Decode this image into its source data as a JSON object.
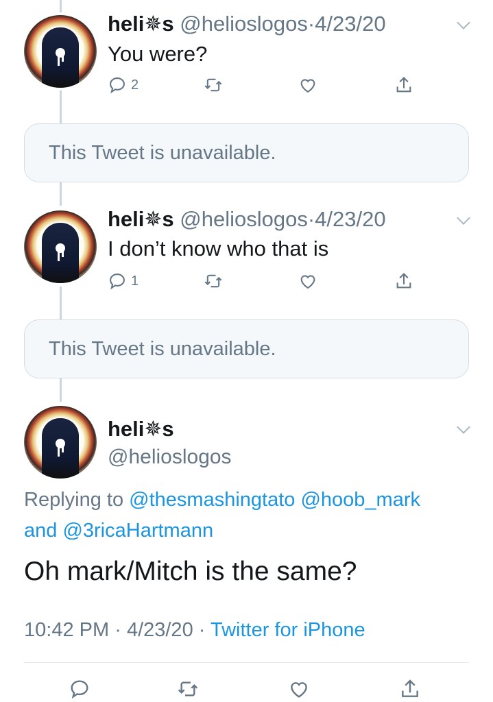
{
  "tweets": [
    {
      "name_prefix": "heli",
      "name_symbol": "✵",
      "name_suffix": "s",
      "handle": "@helioslogos",
      "sep": "·",
      "date": "4/23/20",
      "text": "You were?",
      "reply_count": "2"
    },
    {
      "name_prefix": "heli",
      "name_symbol": "✵",
      "name_suffix": "s",
      "handle": "@helioslogos",
      "sep": "·",
      "date": "4/23/20",
      "text": "I don’t know who that is",
      "reply_count": "1"
    }
  ],
  "unavailable_notice": "This Tweet is unavailable.",
  "main_tweet": {
    "name_prefix": "heli",
    "name_symbol": "✵",
    "name_suffix": "s",
    "handle": "@helioslogos",
    "replying_to_label": "Replying to",
    "replying_to_1": "@thesmashingtato",
    "replying_to_2": "@hoob_mark",
    "and_label": "and",
    "replying_to_3": "@3ricaHartmann",
    "text": "Oh mark/Mitch is the same?",
    "time": "10:42 PM",
    "sep": "·",
    "date": "4/23/20",
    "source": "Twitter for iPhone"
  },
  "colors": {
    "link": "#1b95e0",
    "secondary": "#657786",
    "thread_line": "#ccd6dd"
  },
  "icons": [
    "reply-icon",
    "retweet-icon",
    "like-icon",
    "share-icon",
    "chevron-down-icon"
  ]
}
